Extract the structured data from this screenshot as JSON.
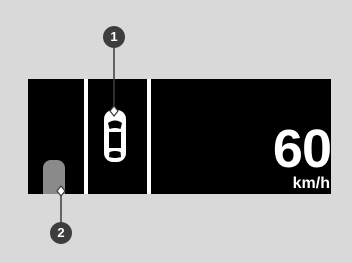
{
  "display": {
    "speed_value": "60",
    "speed_unit": "km/h"
  },
  "callouts": {
    "one": "1",
    "two": "2"
  },
  "icons": {
    "vehicle_ahead": "car-top-view-icon",
    "side_vehicle": "vehicle-indicator-icon"
  },
  "colors": {
    "background": "#d9d9d9",
    "screen": "#000000",
    "callout": "#3d3d3d",
    "side_vehicle": "#8a8a8a"
  }
}
